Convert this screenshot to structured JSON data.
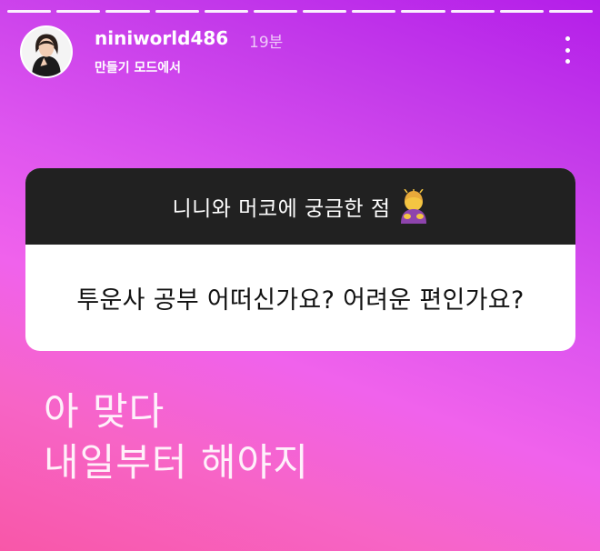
{
  "story": {
    "progress_segments": 12
  },
  "header": {
    "username": "niniworld486",
    "time": "19분",
    "subtitle": "만들기 모드에서",
    "more_icon": "more-vertical-icon"
  },
  "question_card": {
    "title": "니니와 머코에 궁금한 점",
    "title_emoji": "person-bowing-emoji",
    "question": "투운사 공부 어떠신가요? 어려운 편인가요?"
  },
  "reply": {
    "line1": "아 맞다",
    "line2": "내일부터 해야지"
  },
  "colors": {
    "gradient_top": "#b41ee9",
    "gradient_bottom": "#f857a8",
    "card_header": "#212121",
    "card_body": "#ffffff"
  }
}
